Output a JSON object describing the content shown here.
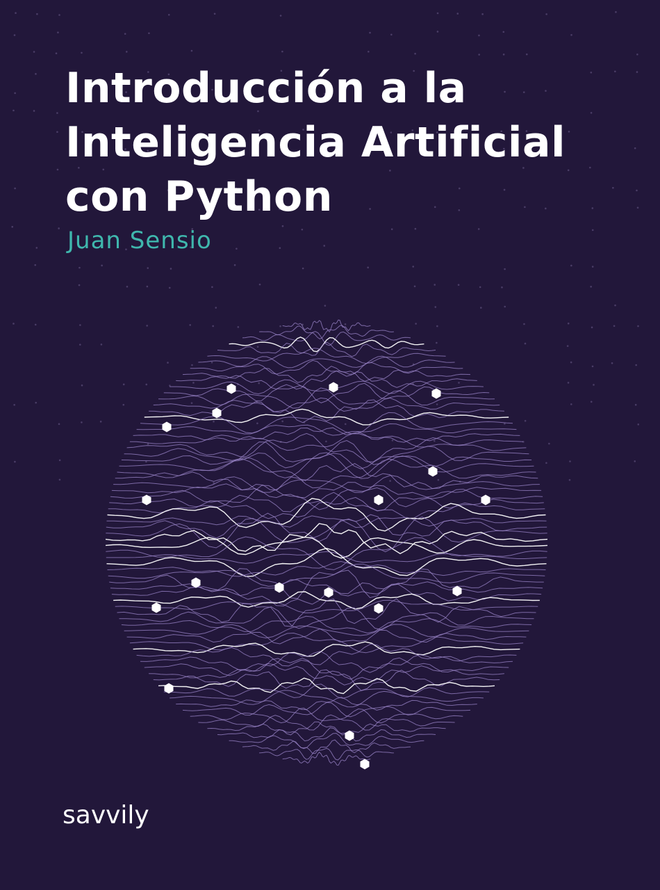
{
  "cover": {
    "title_lines": [
      "Introducción a la",
      "Inteligencia Artificial",
      "con Python"
    ],
    "author": "Juan Sensio",
    "publisher": "savvily"
  },
  "colors": {
    "background": "#22173a",
    "title": "#ffffff",
    "author": "#3fb7ad",
    "lines_primary": "#9b86c9",
    "lines_highlight": "#ffffff",
    "nodes": "#ffffff",
    "dots": "#4a3d66"
  },
  "illustration": {
    "name": "wave-line-sphere",
    "line_count": 72,
    "node_count": 21
  }
}
